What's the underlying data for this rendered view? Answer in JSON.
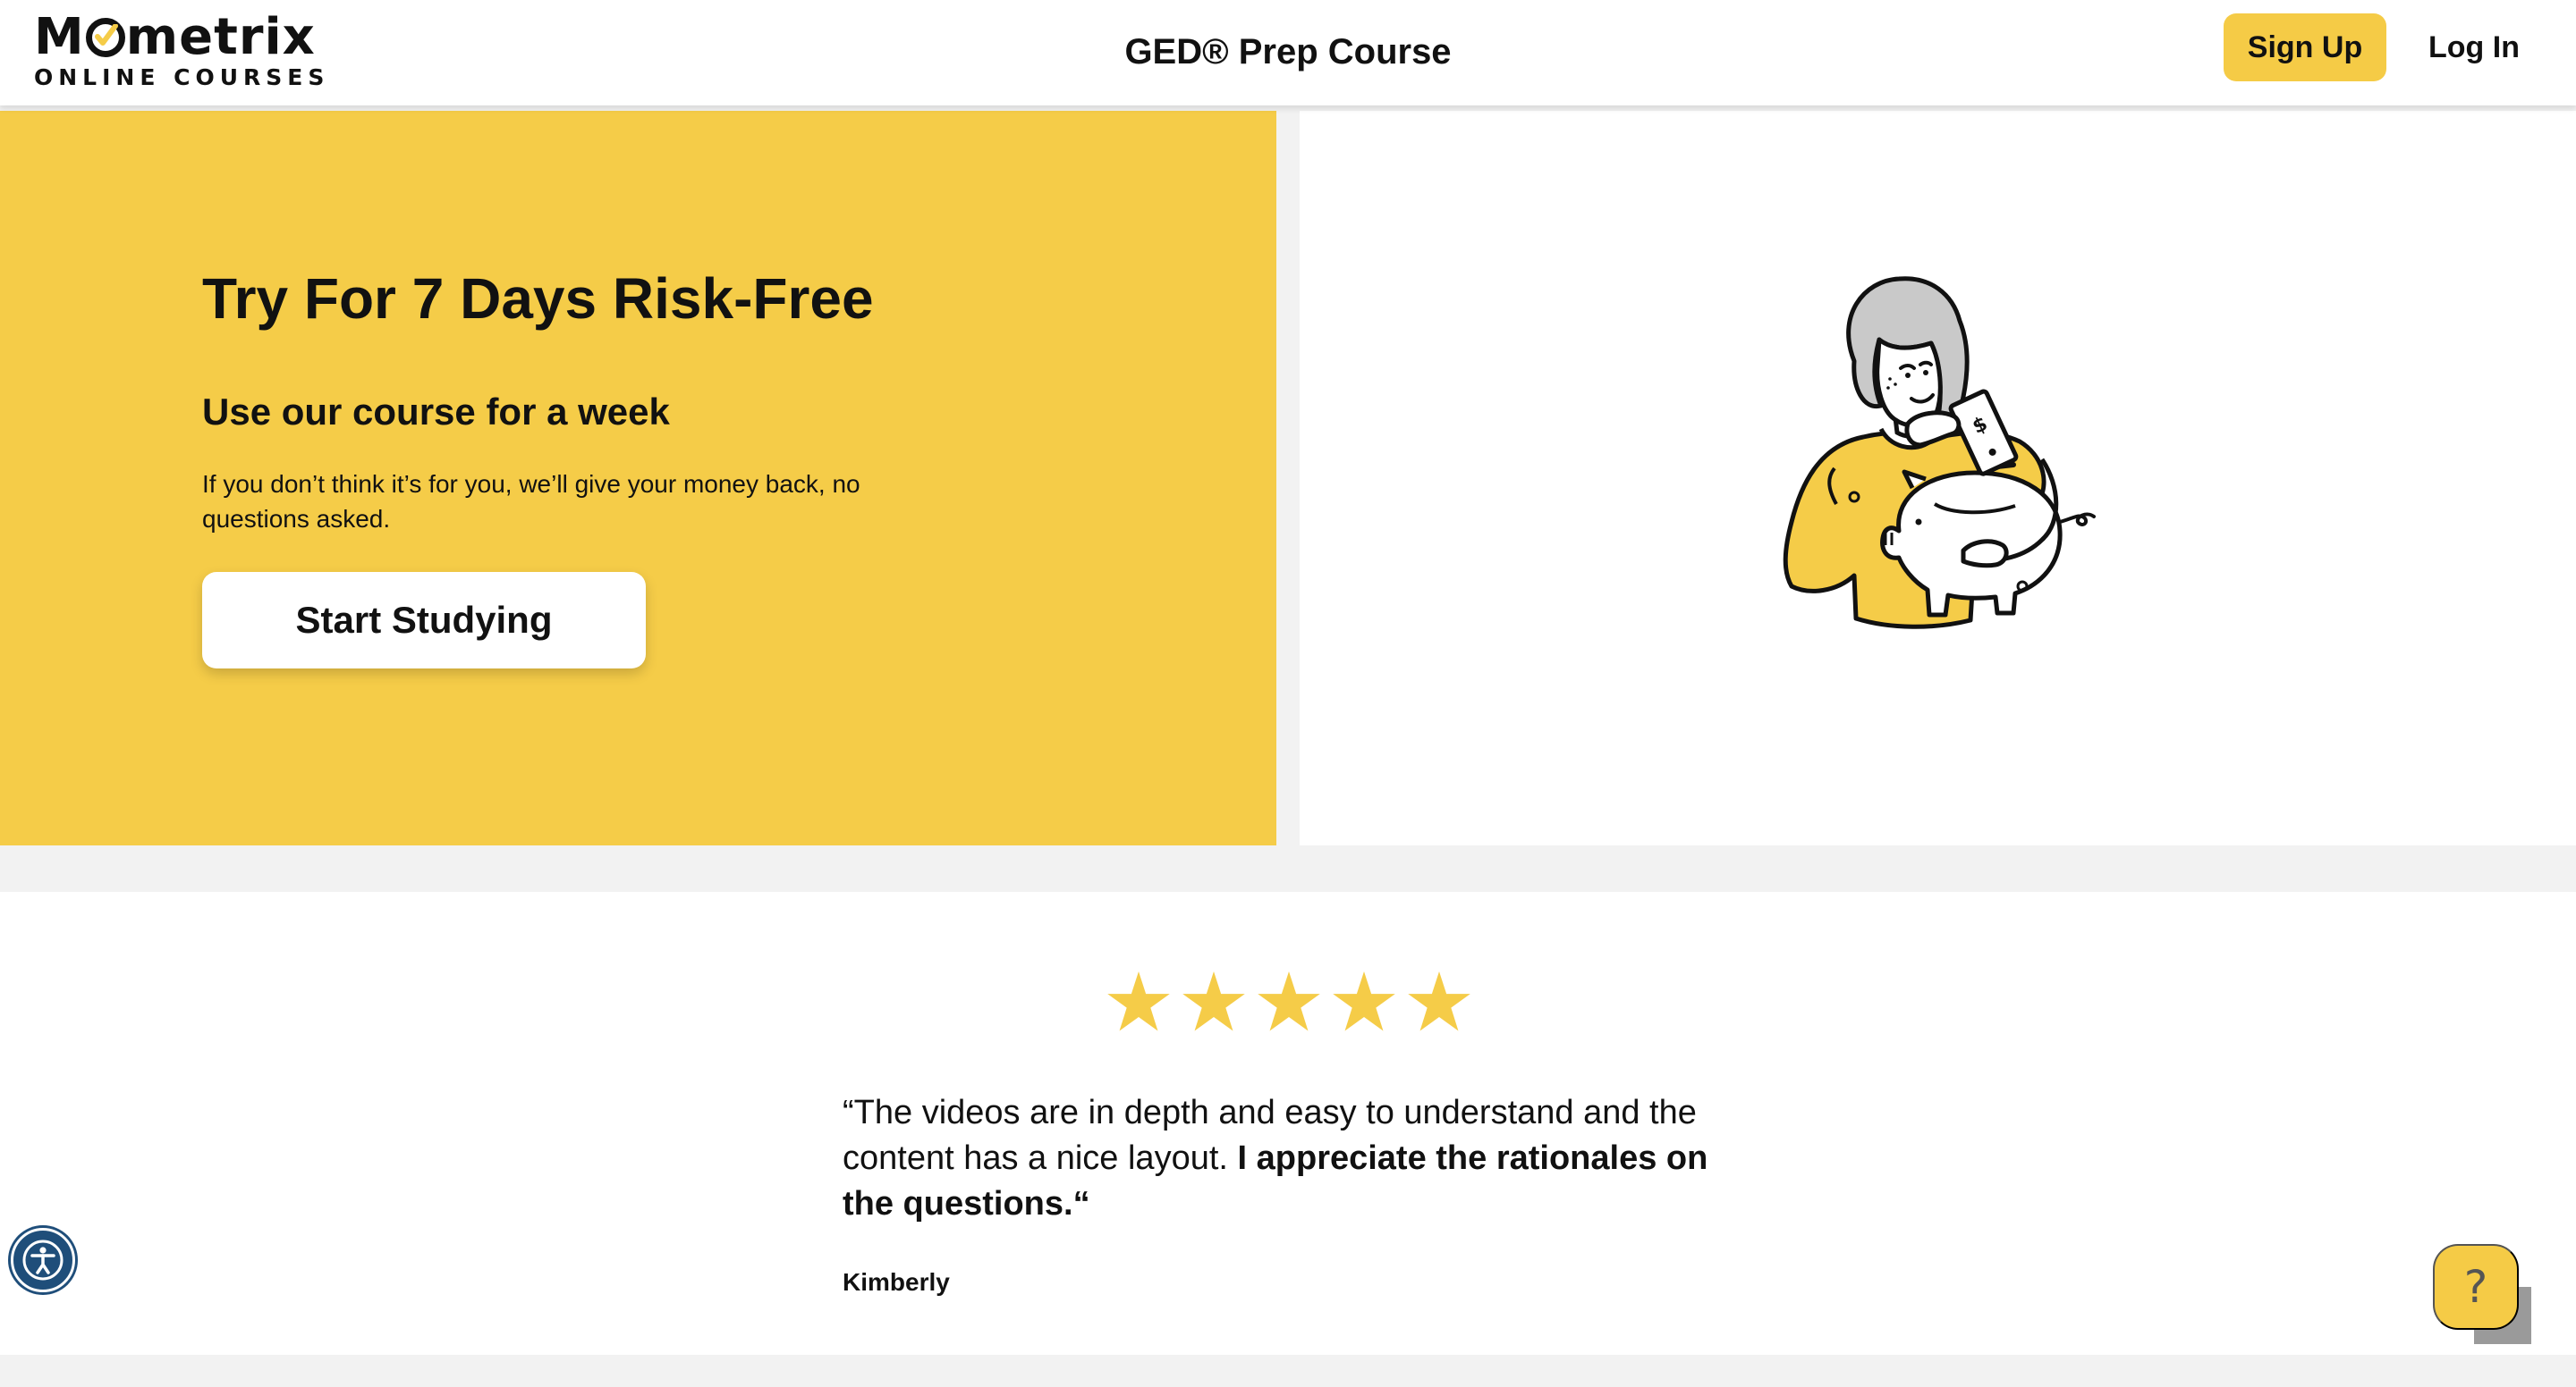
{
  "header": {
    "logo_text": "Mometrix",
    "logo_subtext": "ONLINE COURSES",
    "title": "GED® Prep Course",
    "signup_label": "Sign Up",
    "login_label": "Log In"
  },
  "hero": {
    "heading": "Try For 7 Days Risk-Free",
    "subheading": "Use our course for a week",
    "text": "If you don’t think it’s for you, we’ll give your money back, no questions asked.",
    "cta_label": "Start Studying"
  },
  "testimonial": {
    "rating": 5,
    "rating_max": 5,
    "quote_regular": "“The videos are in depth and easy to understand and the content has a nice layout. ",
    "quote_bold": "I appreciate the rationales on the questions.“",
    "author": "Kimberly"
  },
  "widgets": {
    "help_label": "?"
  },
  "icons": {
    "accessibility": "accessibility-icon",
    "star": "star-icon",
    "logo_check": "check-icon"
  },
  "colors": {
    "brand_yellow": "#f5cc48",
    "text": "#111111",
    "accessibility_blue": "#1f4e7a",
    "star": "#f5cc48"
  }
}
